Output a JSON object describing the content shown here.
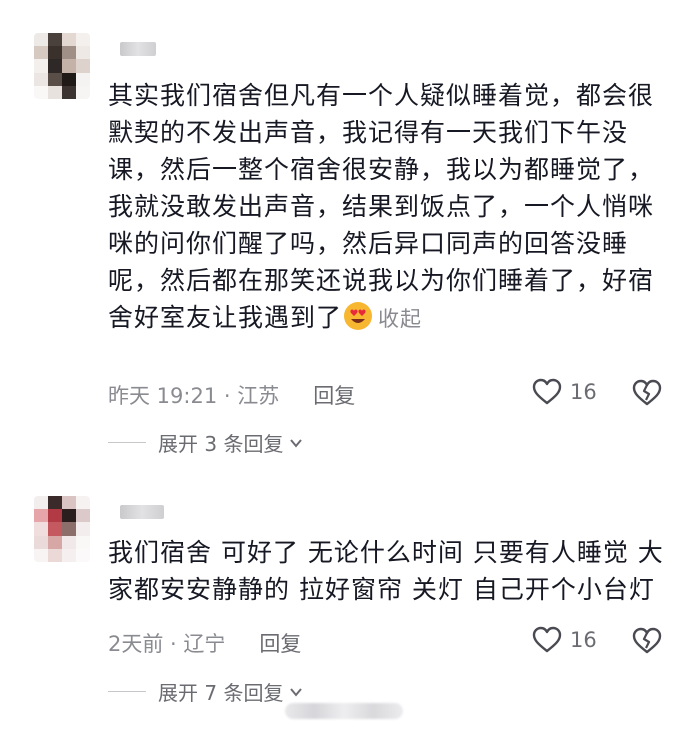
{
  "comments": [
    {
      "text": "其实我们宿舍但凡有一个人疑似睡着觉，都会很默契的不发出声音，我记得有一天我们下午没课，然后一整个宿舍很安静，我以为都睡觉了，我就没敢发出声音，结果到饭点了，一个人悄咪咪的问你们醒了吗，然后异口同声的回答没睡呢，然后都在那笑还说我以为你们睡着了，好宿舍好室友让我遇到了",
      "emoji": "heart-eyes-emoji",
      "collapse_label": "收起",
      "time_location": "昨天 19:21 · 江苏",
      "reply_label": "回复",
      "likes": "16",
      "expand_label": "展开 3 条回复"
    },
    {
      "text": "我们宿舍 可好了 无论什么时间 只要有人睡觉 大家都安安静静的 拉好窗帘 关灯 自己开个小台灯",
      "time_location": "2天前 · 辽宁",
      "reply_label": "回复",
      "likes": "16",
      "expand_label": "展开 7 条回复"
    }
  ],
  "colors": {
    "text": "#161823",
    "secondary": "#8a8b91",
    "action": "#6b6c72"
  },
  "icons": [
    "heart-outline-icon",
    "broken-heart-icon",
    "chevron-down-icon"
  ]
}
